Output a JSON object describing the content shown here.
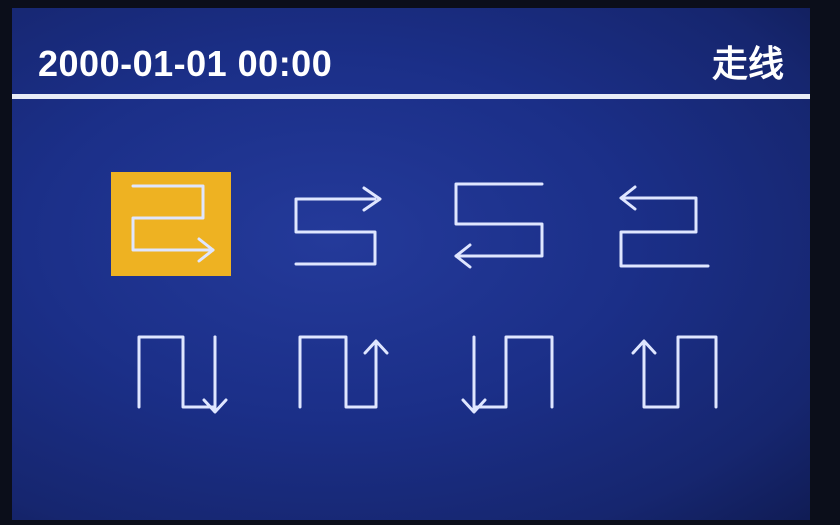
{
  "header": {
    "datetime": "2000-01-01 00:00",
    "title": "走线"
  },
  "wiring_patterns": [
    {
      "icon": "snake-right-start-top-left-icon",
      "selected": true
    },
    {
      "icon": "snake-right-start-top-right-icon",
      "selected": false
    },
    {
      "icon": "snake-left-start-bottom-left-icon",
      "selected": false
    },
    {
      "icon": "snake-left-start-top-left-icon",
      "selected": false
    },
    {
      "icon": "zigzag-down-start-left-icon",
      "selected": false
    },
    {
      "icon": "zigzag-up-start-left-icon",
      "selected": false
    },
    {
      "icon": "zigzag-down-end-left-icon",
      "selected": false
    },
    {
      "icon": "zigzag-up-end-left-icon",
      "selected": false
    }
  ],
  "colors": {
    "screen_bg": "#1b2f88",
    "selected_bg": "#eeb222",
    "icon_stroke": "#dfe6ff",
    "text": "#ffffff"
  }
}
